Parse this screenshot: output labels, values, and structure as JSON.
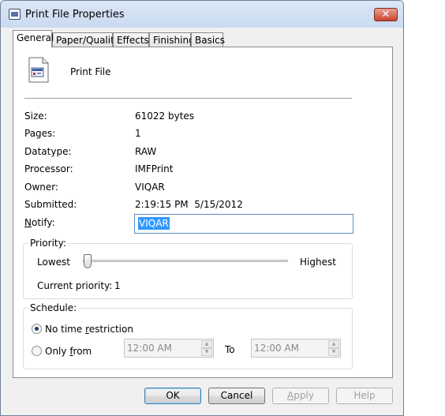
{
  "window": {
    "title": "Print File Properties",
    "close_glyph": "✕"
  },
  "tabs": [
    {
      "label": "General",
      "active": true
    },
    {
      "label": "Paper/Quality",
      "active": false
    },
    {
      "label": "Effects",
      "active": false
    },
    {
      "label": "Finishing",
      "active": false
    },
    {
      "label": "Basics",
      "active": false
    }
  ],
  "general": {
    "document_name": "Print File",
    "fields": {
      "size": {
        "label": "Size:",
        "value": "61022 bytes"
      },
      "pages": {
        "label": "Pages:",
        "value": "1"
      },
      "datatype": {
        "label": "Datatype:",
        "value": "RAW"
      },
      "processor": {
        "label": "Processor:",
        "value": "IMFPrint"
      },
      "owner": {
        "label": "Owner:",
        "value": "VIQAR"
      },
      "submitted": {
        "label": "Submitted:",
        "value": "2:19:15 PM  5/15/2012"
      }
    },
    "notify": {
      "label_accel": "N",
      "label_rest": "otify:",
      "value": "VIQAR"
    }
  },
  "priority": {
    "title": "Priority:",
    "low_label": "Lowest",
    "high_label": "Highest",
    "current_label": "Current priority:",
    "current_value": "1",
    "slider_min": 1,
    "slider_max": 99,
    "slider_value": 1
  },
  "schedule": {
    "title": "Schedule:",
    "no_restriction": {
      "pre": "No time ",
      "accel": "r",
      "post": "estriction",
      "checked": true
    },
    "only_from": {
      "pre": "Only ",
      "accel": "f",
      "post": "rom",
      "checked": false
    },
    "from_time": "12:00 AM",
    "to_label": "To",
    "to_time": "12:00 AM"
  },
  "buttons": {
    "ok": "OK",
    "cancel": "Cancel",
    "apply_accel": "A",
    "apply_rest": "pply",
    "help": "Help"
  },
  "colors": {
    "selection": "#3399ff",
    "window_bg": "#f0f0f0",
    "close": "#c8462f"
  }
}
